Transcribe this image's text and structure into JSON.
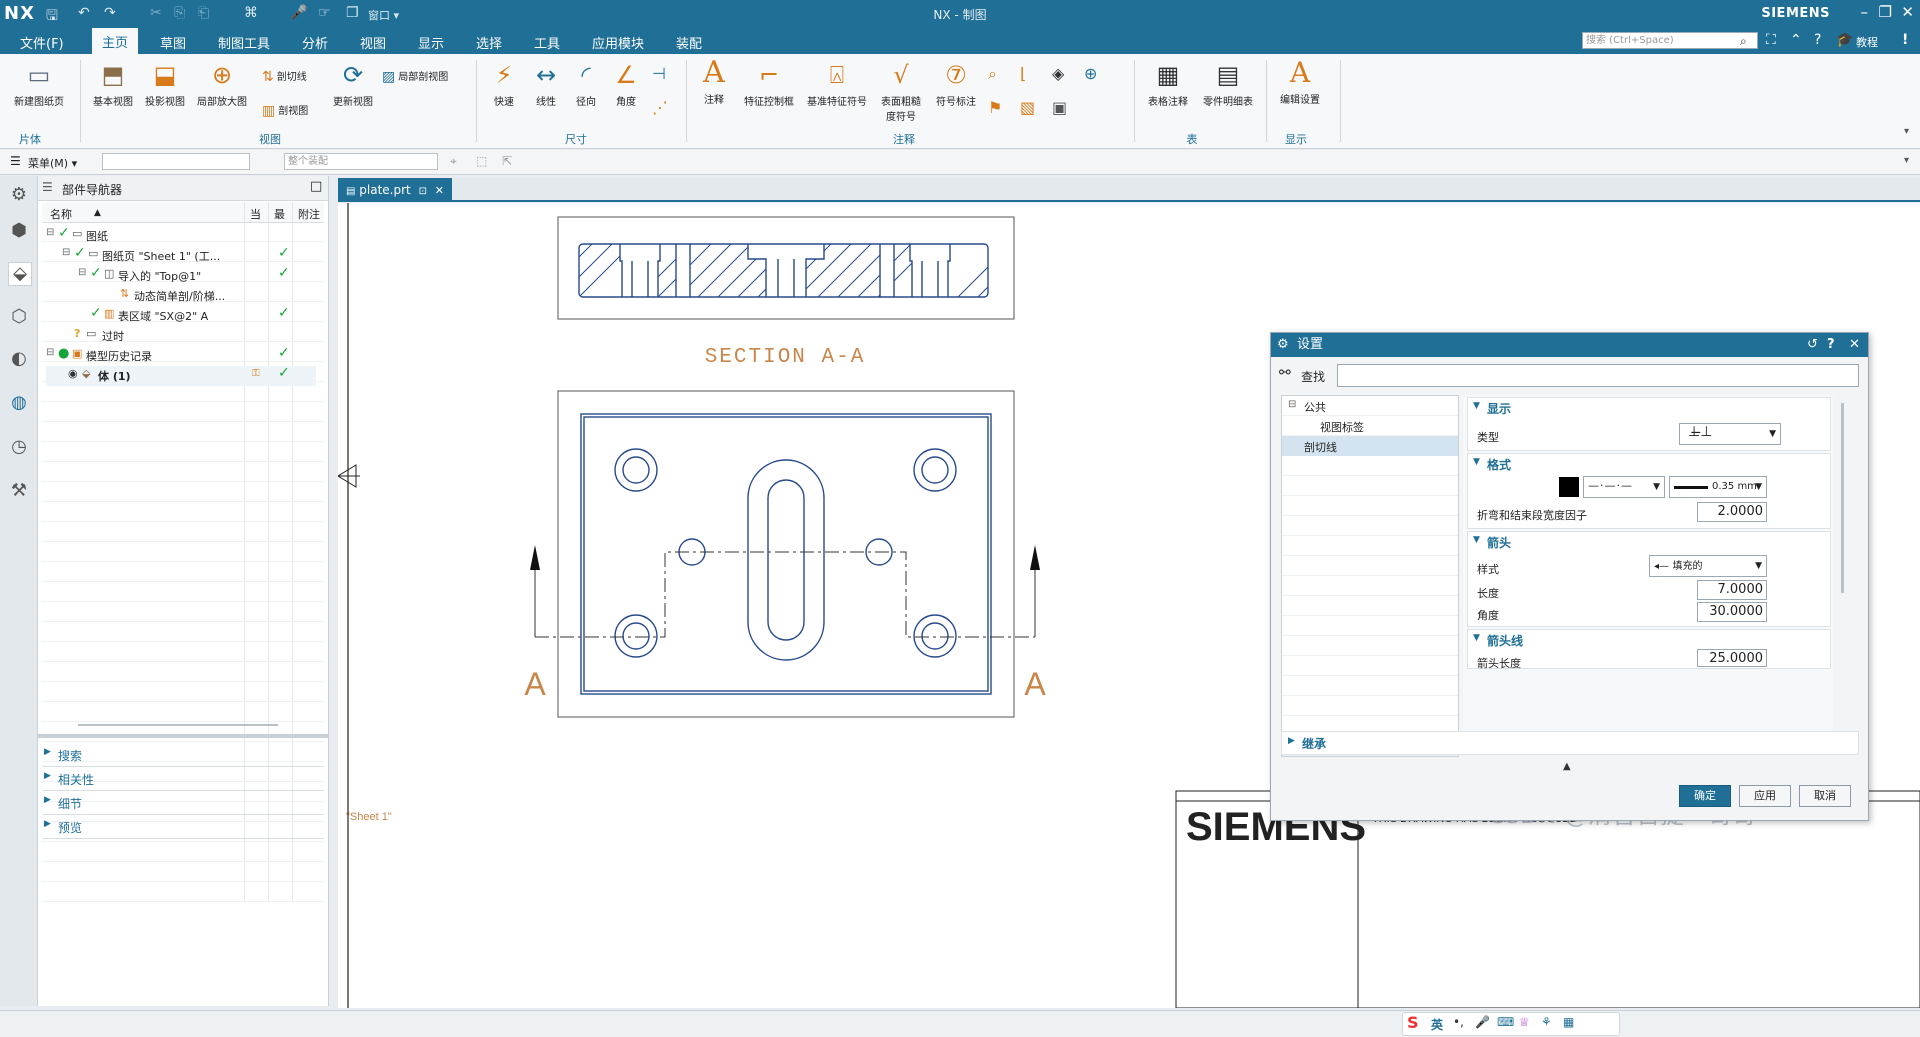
{
  "app": {
    "logo": "NX",
    "title": "NX - 制图",
    "brand": "SIEMENS",
    "window_label": "窗口"
  },
  "menu": {
    "items": [
      "文件(F)",
      "主页",
      "草图",
      "制图工具",
      "分析",
      "视图",
      "显示",
      "选择",
      "工具",
      "应用模块",
      "装配"
    ],
    "active_index": 1,
    "search_placeholder": "搜索 (Ctrl+Space)",
    "tutorial": "教程"
  },
  "ribbon": {
    "groups": [
      {
        "label": "片体",
        "buttons": [
          "新建图纸页"
        ]
      },
      {
        "label": "视图",
        "buttons": [
          "基本视图",
          "投影视图",
          "局部放大图",
          "剖切线",
          "剖视图",
          "更新视图",
          "局部剖视图"
        ]
      },
      {
        "label": "尺寸",
        "buttons": [
          "快速",
          "线性",
          "径向",
          "角度"
        ]
      },
      {
        "label": "注释",
        "buttons": [
          "注释",
          "特征控制框",
          "基准特征符号",
          "表面粗糙度符号",
          "符号标注"
        ]
      },
      {
        "label": "表",
        "buttons": [
          "表格注释",
          "零件明细表"
        ]
      },
      {
        "label": "显示",
        "buttons": [
          "编辑设置"
        ]
      }
    ]
  },
  "cmdrow": {
    "menu_label": "菜单(M)",
    "assembly_placeholder": "整个装配"
  },
  "navigator": {
    "title": "部件导航器",
    "columns": [
      "名称",
      "当",
      "最",
      "附注"
    ],
    "rows": [
      {
        "label": "图纸",
        "indent": 0
      },
      {
        "label": "图纸页 \"Sheet 1\" (工...",
        "indent": 1
      },
      {
        "label": "导入的 \"Top@1\"",
        "indent": 2
      },
      {
        "label": "动态简单剖/阶梯...",
        "indent": 3
      },
      {
        "label": "表区域 \"SX@2\" A",
        "indent": 2
      },
      {
        "label": "过时",
        "indent": 1
      },
      {
        "label": "模型历史记录",
        "indent": 0
      },
      {
        "label": "体 (1)",
        "indent": 1
      }
    ],
    "sections": [
      "搜索",
      "相关性",
      "细节",
      "预览"
    ]
  },
  "tab": {
    "label": "plate.prt"
  },
  "drawing": {
    "section_label": "SECTION A-A",
    "cut_label_left": "A",
    "cut_label_right": "A",
    "sheet_name": "\"Sheet 1\"",
    "title_block_brand": "SIEMENS",
    "title_block_text": "THIS DRAWING HAS BEEN PRODUCED",
    "watermark": "CSDN @清音苔提一哥哥"
  },
  "dialog": {
    "title": "设置",
    "find_label": "查找",
    "tree": [
      {
        "label": "公共",
        "level": 0
      },
      {
        "label": "视图标签",
        "level": 1
      },
      {
        "label": "剖切线",
        "level": 0,
        "selected": true
      }
    ],
    "sections": {
      "display": "显示",
      "format": "格式",
      "arrow": "箭头",
      "arrow_line": "箭头线",
      "inherit": "继承"
    },
    "type_label": "类型",
    "line_width": "0.35 mm",
    "bend_factor_label": "折弯和结束段宽度因子",
    "bend_factor_value": "2.0000",
    "style_label": "样式",
    "style_value": "填充的",
    "length_label": "长度",
    "length_value": "7.0000",
    "angle_label": "角度",
    "angle_value": "30.0000",
    "arrow_length_label": "箭头长度",
    "arrow_length_value": "25.0000",
    "buttons": {
      "ok": "确定",
      "apply": "应用",
      "cancel": "取消"
    }
  },
  "ime": {
    "lang": "英"
  },
  "colors": {
    "brand": "#1f6f97",
    "drawing_line": "#274a8c",
    "label_orange": "#c8864a",
    "check_green": "#17a53a"
  }
}
